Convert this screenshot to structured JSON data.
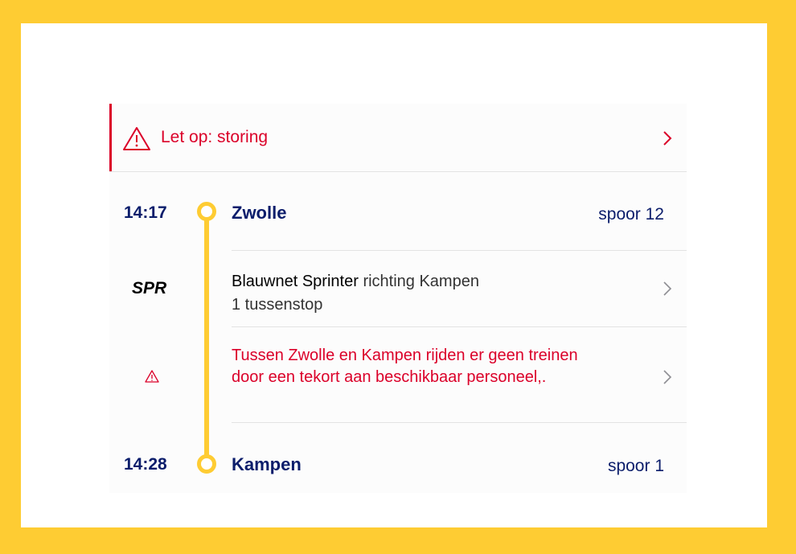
{
  "alert": {
    "icon": "warning-triangle-icon",
    "text": "Let op: storing",
    "chevron": "chevron-right-icon"
  },
  "departure": {
    "time": "14:17",
    "station": "Zwolle",
    "track": "spoor 12"
  },
  "train": {
    "type": "SPR",
    "name": "Blauwnet Sprinter",
    "direction": "richting Kampen",
    "stops": "1 tussenstop"
  },
  "disruption": {
    "icon": "warning-triangle-icon",
    "text": "Tussen Zwolle en Kampen rijden er geen treinen door een tekort aan beschikbaar personeel,."
  },
  "arrival": {
    "time": "14:28",
    "station": "Kampen",
    "track": "spoor 1"
  },
  "colors": {
    "accent": "#fecc33",
    "navy": "#0b1d6b",
    "alert": "#db0029"
  }
}
